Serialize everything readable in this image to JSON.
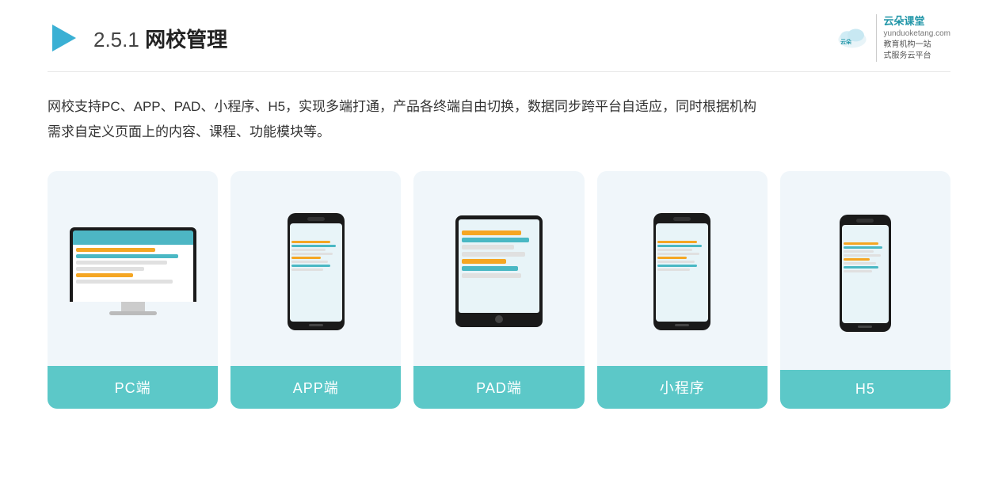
{
  "header": {
    "title_prefix": "2.5.1 ",
    "title_bold": "网校管理",
    "logo_alt": "play icon"
  },
  "brand": {
    "name": "云朵课堂",
    "domain": "yunduoketang.com",
    "tagline1": "教育机构一站",
    "tagline2": "式服务云平台"
  },
  "description": {
    "line1": "网校支持PC、APP、PAD、小程序、H5，实现多端打通，产品各终端自由切换，数据同步跨平台自适应，同时根据机构",
    "line2": "需求自定义页面上的内容、课程、功能模块等。"
  },
  "cards": [
    {
      "id": "pc",
      "label": "PC端",
      "type": "pc"
    },
    {
      "id": "app",
      "label": "APP端",
      "type": "phone"
    },
    {
      "id": "pad",
      "label": "PAD端",
      "type": "tablet"
    },
    {
      "id": "mini",
      "label": "小程序",
      "type": "phone"
    },
    {
      "id": "h5",
      "label": "H5",
      "type": "phone"
    }
  ],
  "colors": {
    "card_bg": "#eef5fa",
    "card_label_bg": "#5cc9c8",
    "screen_top": "#4ab8c4",
    "bar1": "#f5a623",
    "bar2": "#4ab8c4",
    "bar3": "#e8e8e8"
  }
}
